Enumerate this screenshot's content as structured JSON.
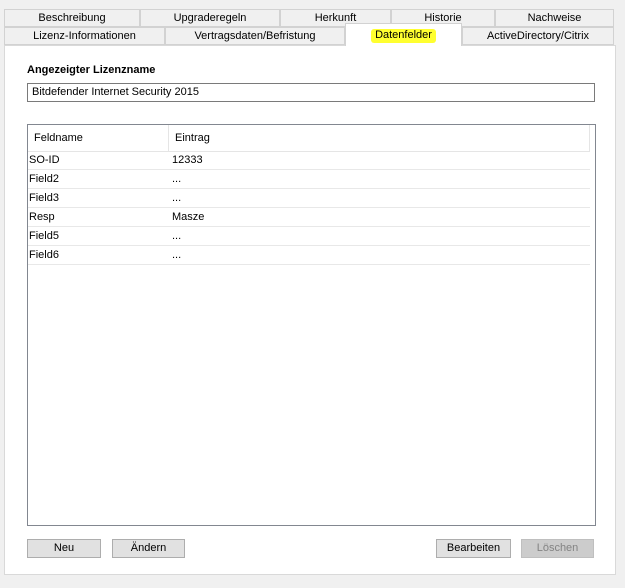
{
  "tabs_row1": [
    {
      "label": "Beschreibung"
    },
    {
      "label": "Upgraderegeln"
    },
    {
      "label": "Herkunft"
    },
    {
      "label": "Historie"
    },
    {
      "label": "Nachweise"
    }
  ],
  "tabs_row2": [
    {
      "label": "Lizenz-Informationen"
    },
    {
      "label": "Vertragsdaten/Befristung"
    },
    {
      "label": "Datenfelder",
      "active": true
    },
    {
      "label": "ActiveDirectory/Citrix"
    }
  ],
  "highlight_color": "#ffff30",
  "license": {
    "label": "Angezeigter Lizenzname",
    "value": "Bitdefender Internet Security 2015"
  },
  "grid": {
    "columns": [
      "Feldname",
      "Eintrag"
    ],
    "rows": [
      {
        "name": "SO-ID",
        "value": "12333"
      },
      {
        "name": "Field2",
        "value": "..."
      },
      {
        "name": "Field3",
        "value": "..."
      },
      {
        "name": "Resp",
        "value": "Masze"
      },
      {
        "name": "Field5",
        "value": "..."
      },
      {
        "name": "Field6",
        "value": "..."
      }
    ]
  },
  "buttons": {
    "new": "Neu",
    "change": "Ändern",
    "edit": "Bearbeiten",
    "delete": "Löschen"
  }
}
